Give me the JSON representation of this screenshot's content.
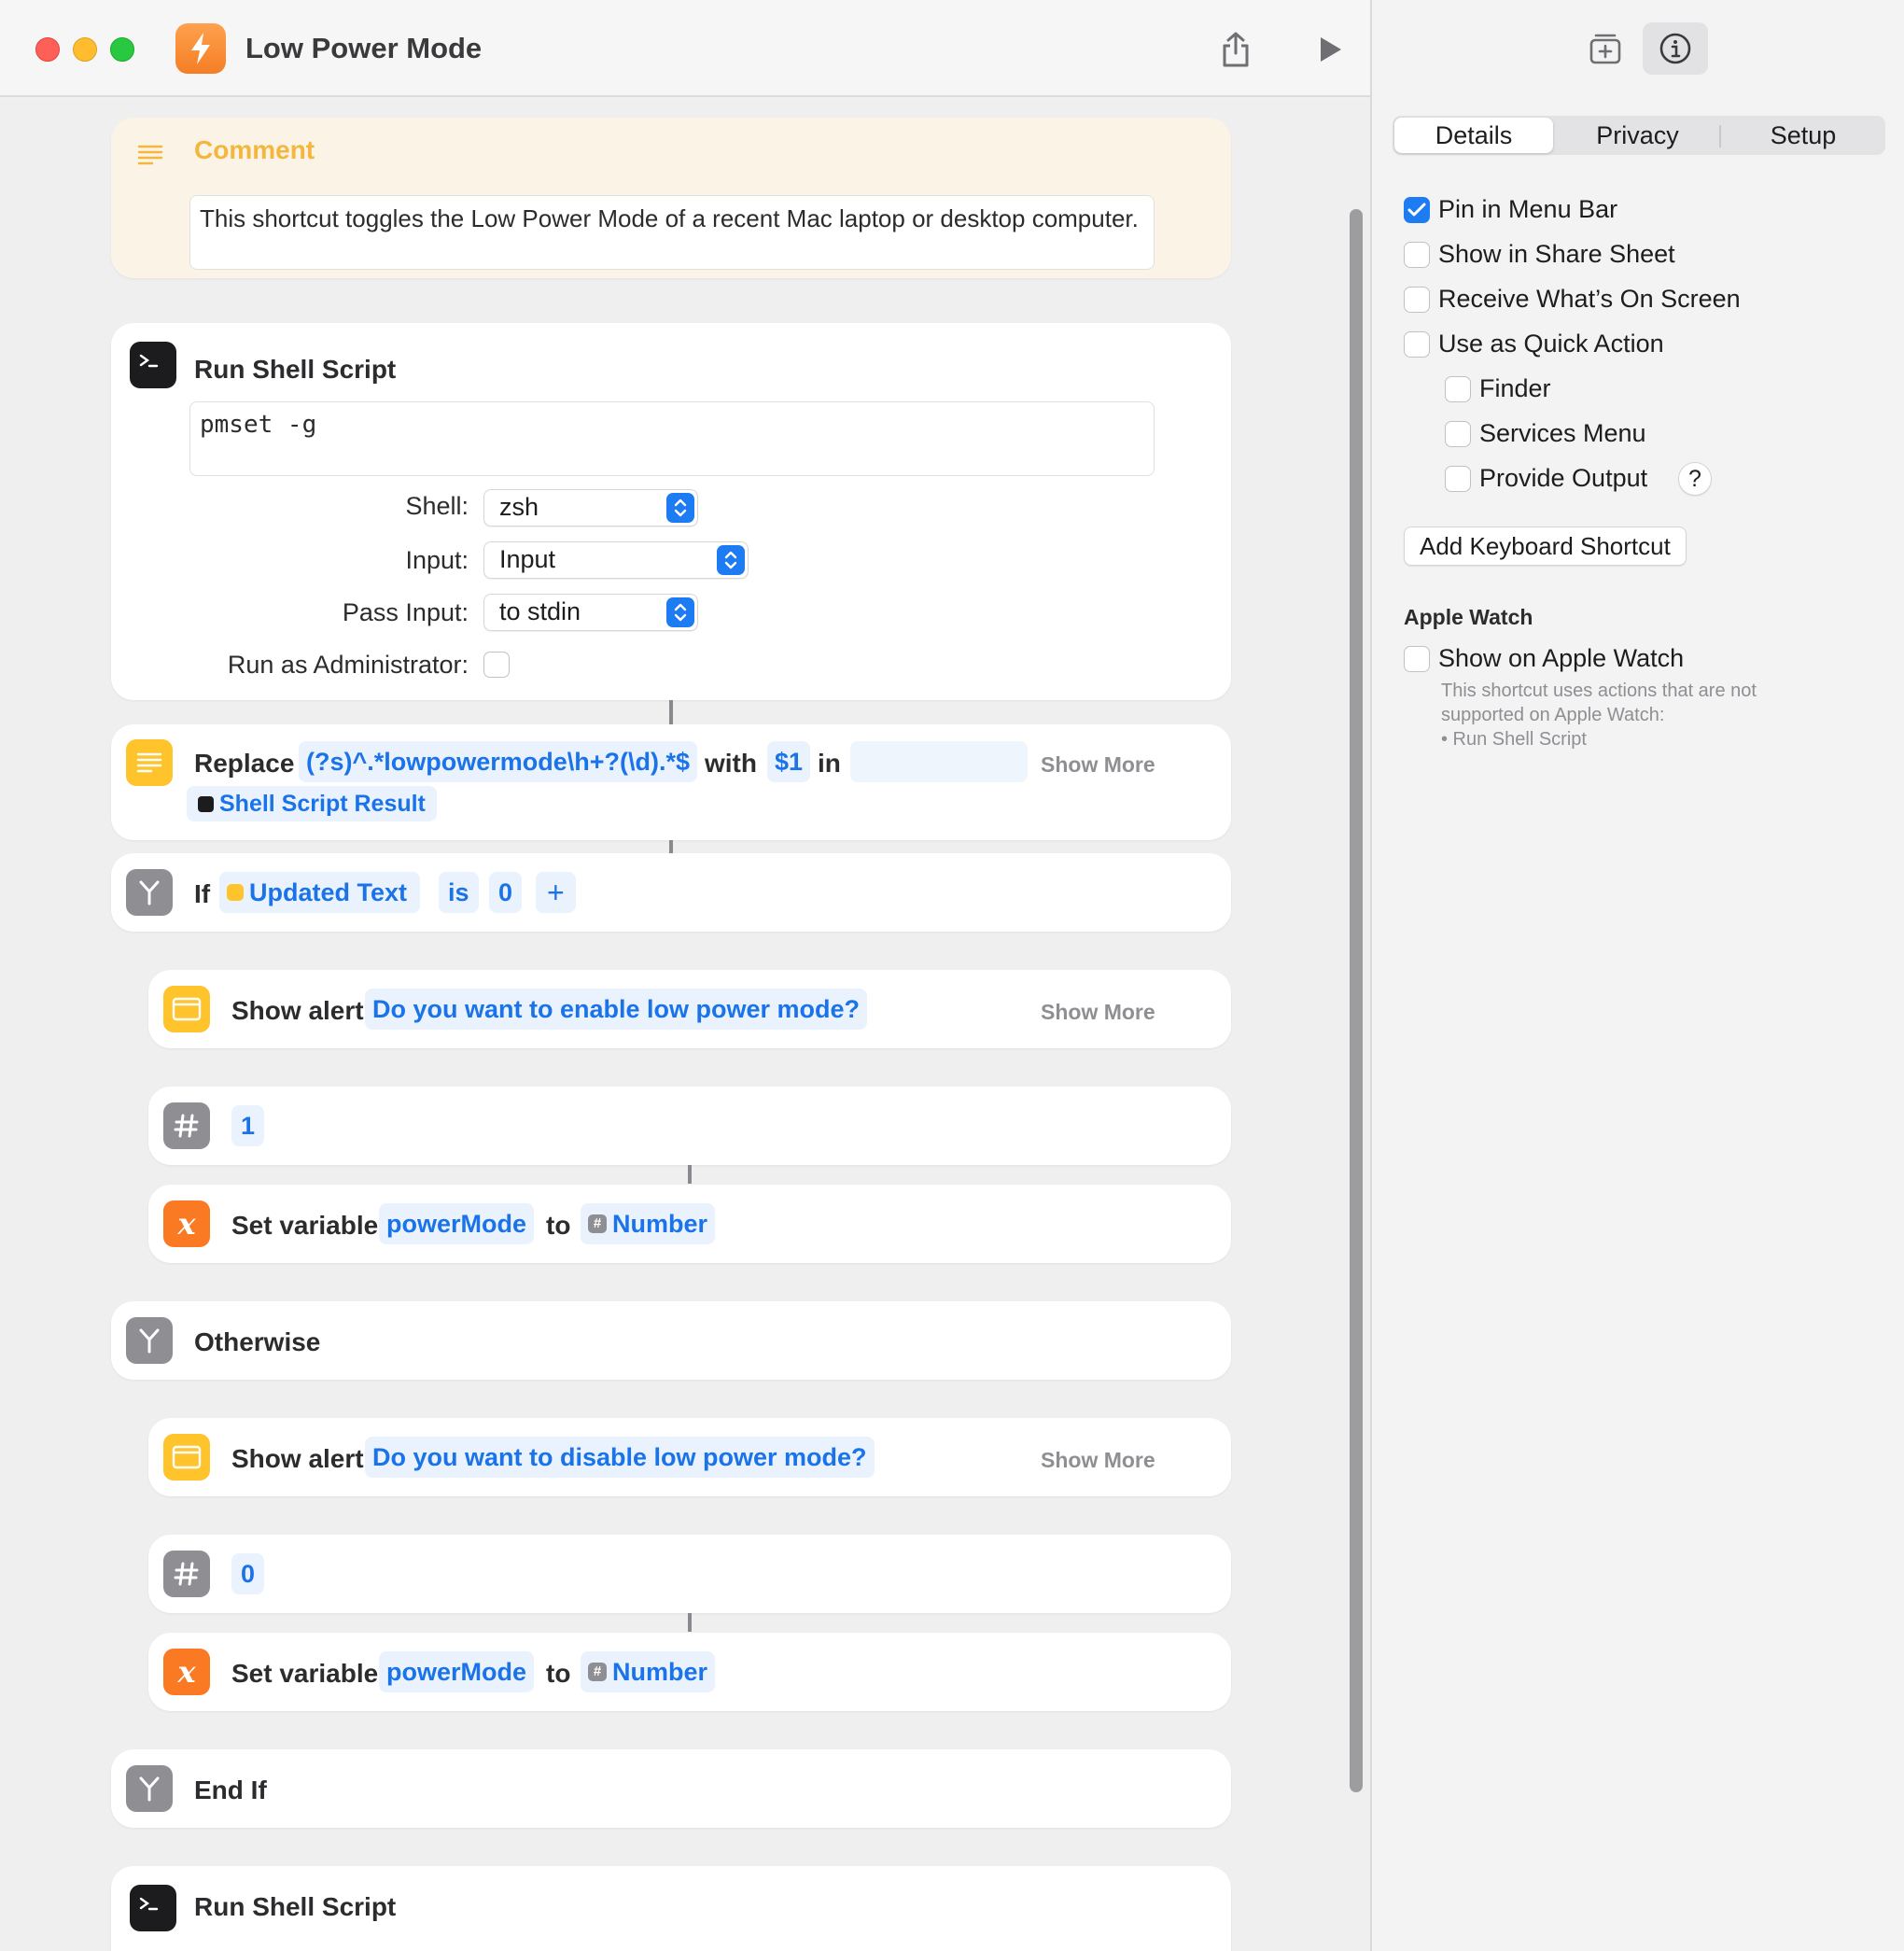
{
  "window": {
    "title": "Low Power Mode"
  },
  "colors": {
    "accent": "#1e7cf2",
    "token_text": "#1a73e8",
    "comment_title": "#f4b73d",
    "app_icon": "#f47e25"
  },
  "icons": {
    "app": "lightning-bolt-icon",
    "share": "share-icon",
    "run": "play-icon",
    "library": "add-action-icon",
    "info": "info-icon"
  },
  "comment": {
    "title": "Comment",
    "text": "This shortcut toggles the Low Power Mode of a recent Mac laptop or desktop computer."
  },
  "shell1": {
    "title": "Run Shell Script",
    "script": "pmset -g",
    "shell_label": "Shell:",
    "shell_value": "zsh",
    "input_label": "Input:",
    "input_value": "Input",
    "pass_label": "Pass Input:",
    "pass_value": "to stdin",
    "admin_label": "Run as Administrator:"
  },
  "replace": {
    "title": "Replace",
    "pattern": "(?s)^.*lowpowermode\\h+?(\\d).*$",
    "with_word": "with",
    "replacement": "$1",
    "in_word": "in",
    "source": "Shell Script Result",
    "show_more": "Show More"
  },
  "if_block": {
    "title": "If",
    "variable": "Updated Text",
    "operator": "is",
    "value": "0",
    "add": "+"
  },
  "alert1": {
    "title": "Show alert",
    "message": "Do you want to enable low power mode?",
    "show_more": "Show More"
  },
  "number1": {
    "value": "1"
  },
  "setvar1": {
    "title": "Set variable",
    "name": "powerMode",
    "to_word": "to",
    "value": "Number"
  },
  "otherwise": {
    "title": "Otherwise"
  },
  "alert2": {
    "title": "Show alert",
    "message": "Do you want to disable low power mode?",
    "show_more": "Show More"
  },
  "number2": {
    "value": "0"
  },
  "setvar2": {
    "title": "Set variable",
    "name": "powerMode",
    "to_word": "to",
    "value": "Number"
  },
  "endif": {
    "title": "End If"
  },
  "shell2": {
    "title": "Run Shell Script"
  },
  "sidebar": {
    "tabs": [
      "Details",
      "Privacy",
      "Setup"
    ],
    "active_tab": "Details",
    "options": {
      "pin_menu_bar": "Pin in Menu Bar",
      "share_sheet": "Show in Share Sheet",
      "receive_screen": "Receive What’s On Screen",
      "quick_action": "Use as Quick Action",
      "finder": "Finder",
      "services_menu": "Services Menu",
      "provide_output": "Provide Output"
    },
    "help": "?",
    "keyboard_shortcut": "Add Keyboard Shortcut",
    "apple_watch_head": "Apple Watch",
    "show_on_watch": "Show on Apple Watch",
    "watch_note_1": "This shortcut uses actions that are not",
    "watch_note_2": "supported on Apple Watch:",
    "watch_note_3": "• Run Shell Script"
  }
}
